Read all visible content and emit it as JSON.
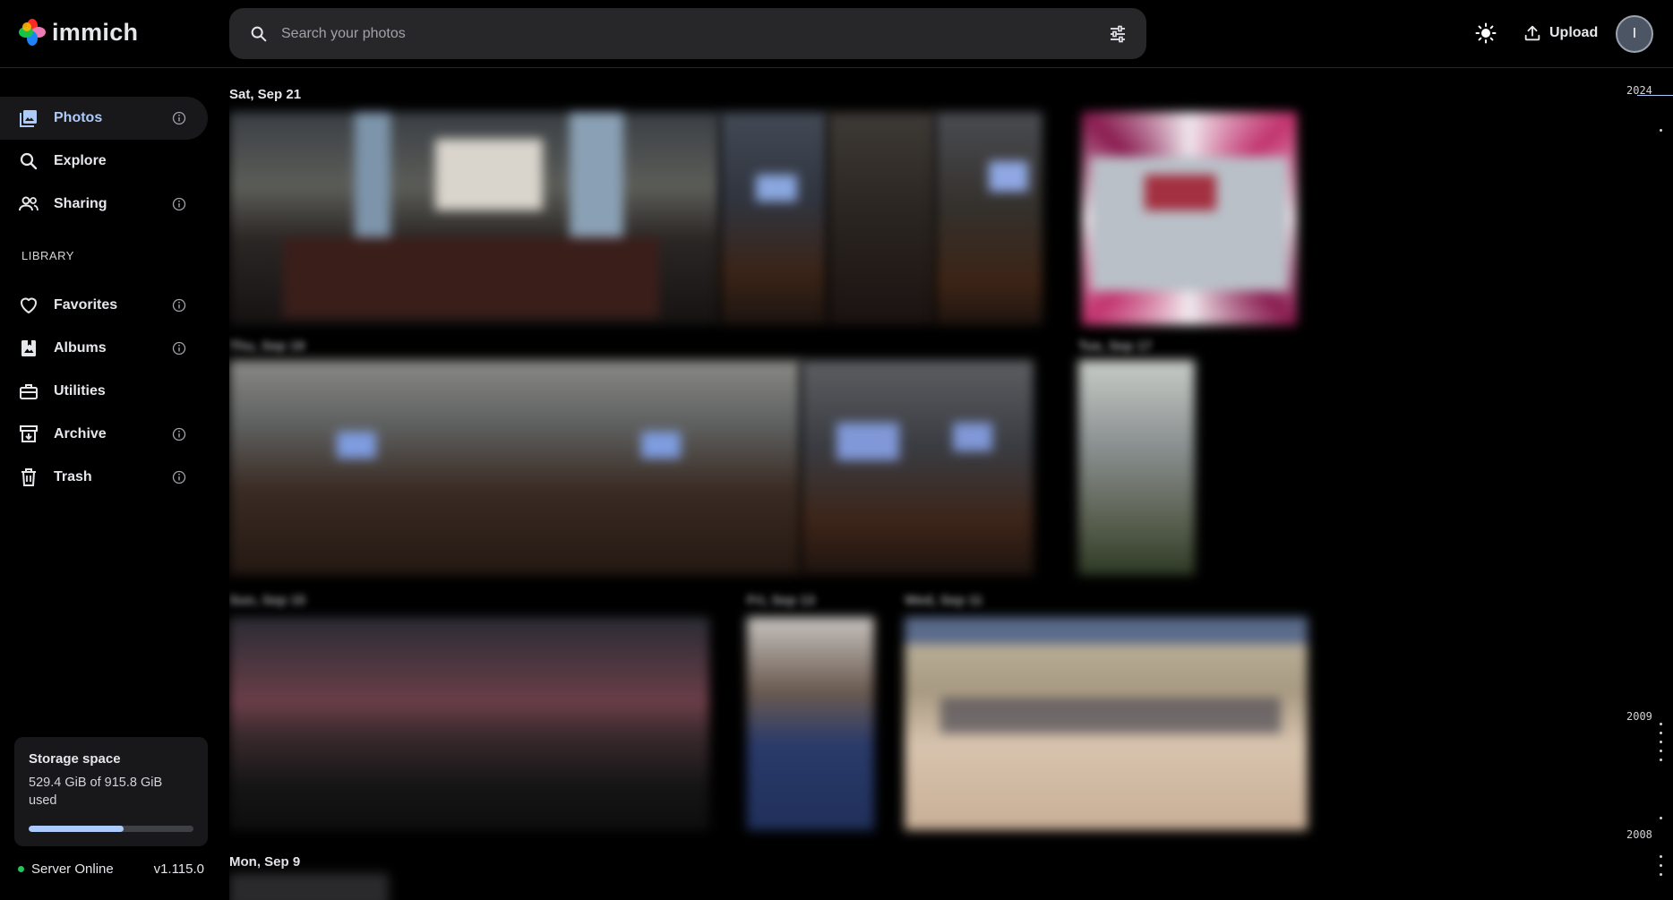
{
  "app": {
    "name": "immich"
  },
  "search": {
    "placeholder": "Search your photos"
  },
  "header": {
    "upload_label": "Upload",
    "avatar_initial": "I"
  },
  "sidebar": {
    "items": [
      {
        "label": "Photos",
        "icon": "photos-icon",
        "active": true
      },
      {
        "label": "Explore",
        "icon": "explore-icon"
      },
      {
        "label": "Sharing",
        "icon": "sharing-icon"
      },
      {
        "label": "Favorites",
        "icon": "heart-icon"
      },
      {
        "label": "Albums",
        "icon": "albums-icon"
      },
      {
        "label": "Utilities",
        "icon": "utilities-icon"
      },
      {
        "label": "Archive",
        "icon": "archive-icon"
      },
      {
        "label": "Trash",
        "icon": "trash-icon"
      }
    ],
    "library_label": "LIBRARY"
  },
  "storage": {
    "title": "Storage space",
    "usage": "529.4 GiB of 915.8 GiB used",
    "used_fraction": 0.578
  },
  "server": {
    "status": "Server Online",
    "version": "v1.115.0"
  },
  "timeline": {
    "groups": [
      {
        "date": "Sat, Sep 21"
      },
      {
        "date": "Mon, Sep 9"
      }
    ]
  },
  "scrubber": {
    "years": [
      "2024",
      "2009",
      "2008"
    ]
  },
  "colors": {
    "accent": "#adcbfa",
    "background": "#000000",
    "surface": "#18181b",
    "online": "#22c55e"
  }
}
